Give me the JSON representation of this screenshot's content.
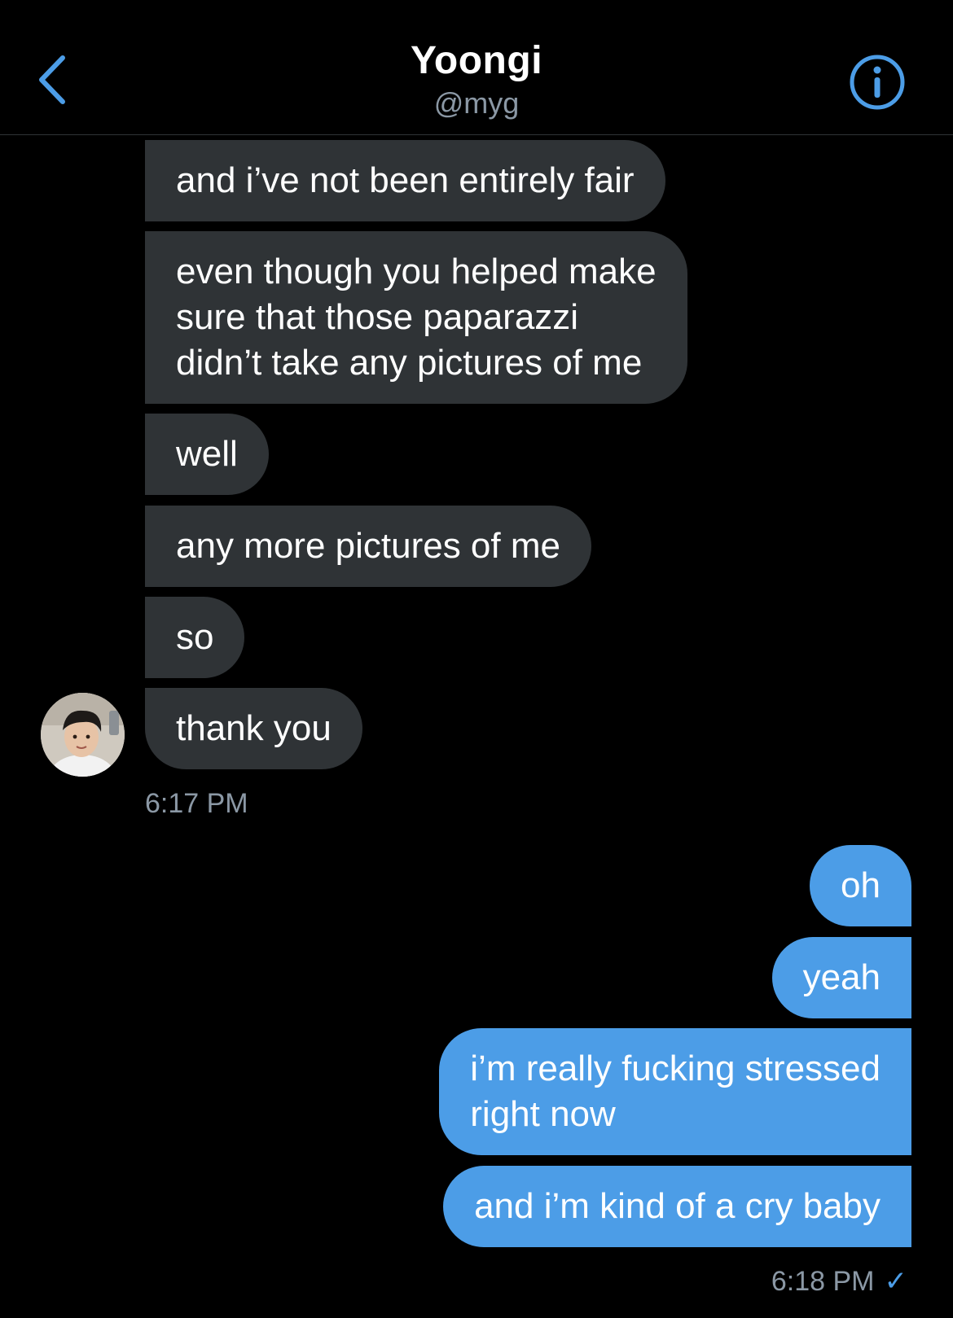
{
  "header": {
    "title": "Yoongi",
    "handle": "@myg"
  },
  "colors": {
    "background": "#000000",
    "received_bubble": "#2f3336",
    "sent_bubble": "#4c9de7",
    "accent": "#4c9de7",
    "muted_text": "#8b98a5"
  },
  "icons": {
    "back": "chevron-left-icon",
    "info": "info-circle-icon",
    "read_receipt": "checkmark-icon"
  },
  "received": [
    {
      "lines": [
        "and i’ve not been entirely fair"
      ]
    },
    {
      "lines": [
        "even though you helped make",
        "sure that those paparazzi",
        "didn’t take any pictures of me"
      ]
    },
    {
      "lines": [
        "well"
      ]
    },
    {
      "lines": [
        "any more pictures of me"
      ]
    },
    {
      "lines": [
        "so"
      ]
    },
    {
      "lines": [
        "thank you"
      ]
    }
  ],
  "received_time": "6:17 PM",
  "sent": [
    {
      "lines": [
        "oh"
      ]
    },
    {
      "lines": [
        "yeah"
      ]
    },
    {
      "lines": [
        "i’m really fucking stressed",
        "right now"
      ]
    },
    {
      "lines": [
        "and i’m kind of a cry baby"
      ]
    }
  ],
  "sent_time": "6:18 PM",
  "sent_receipt": "✓"
}
